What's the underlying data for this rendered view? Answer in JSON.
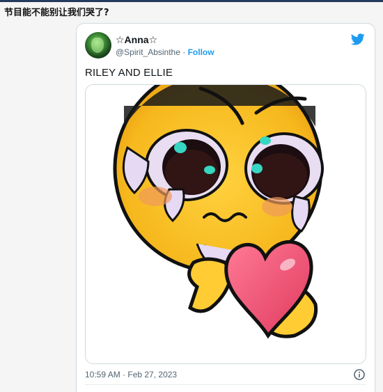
{
  "page": {
    "question": "节目能不能别让我们哭了?"
  },
  "tweet": {
    "display_name": "☆Anna☆",
    "handle": "@Spirit_Absinthe",
    "separator": "·",
    "follow_label": "Follow",
    "text": "RILEY AND ELLIE",
    "timestamp": "10:59 AM · Feb 27, 2023",
    "media_alt": "crying cursed emoji holding a heart",
    "icons": {
      "logo": "twitter-bird-icon",
      "info": "info-icon"
    }
  },
  "colors": {
    "accent": "#1d9bf0",
    "top_bar": "#243a5e",
    "text": "#0f1419",
    "muted": "#536471",
    "border": "#cfd9de"
  }
}
